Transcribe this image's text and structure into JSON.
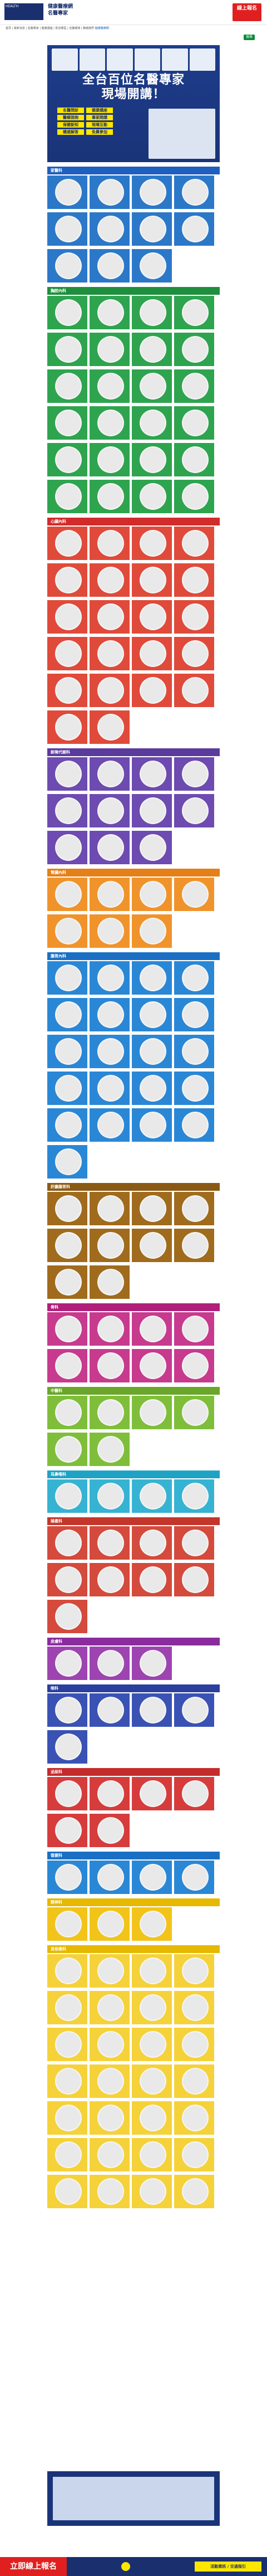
{
  "header": {
    "logo_text": "HEALTH",
    "brand_name": "健康醫療網",
    "sub_logo": "名醫專家",
    "cta_label": "線上報名"
  },
  "subnav": {
    "text": "首頁 | 最新消息 | 名醫專家 | 健康講座 | 影音專區 | 名醫報導 | 聯絡我們",
    "brand": "健康醫療網"
  },
  "search": {
    "button": "搜尋"
  },
  "hero": {
    "label": "名醫專家專區",
    "title_line1": "全台百位名醫專家",
    "title_line2": "現場開講！",
    "tags": [
      "名醫問診",
      "健康講座",
      "醫療諮詢",
      "專家開講",
      "保健新知",
      "現場互動",
      "權威解答",
      "免費參加"
    ]
  },
  "sections": [
    {
      "title": "家醫科",
      "color": "#1f5fbf",
      "cards": [
        "",
        "",
        "",
        "",
        "",
        "",
        "",
        "",
        "",
        "",
        ""
      ],
      "bg": "#2b78c9"
    },
    {
      "title": "胸腔內科",
      "color": "#1e8f3d",
      "cards": [
        "",
        "",
        "",
        "",
        "",
        "",
        "",
        "",
        "",
        "",
        "",
        "",
        "",
        "",
        "",
        "",
        "",
        "",
        "",
        "",
        "",
        "",
        "",
        ""
      ],
      "bg": "#2ea44f"
    },
    {
      "title": "心臟內科",
      "color": "#d22b2b",
      "cards": [
        "",
        "",
        "",
        "",
        "",
        "",
        "",
        "",
        "",
        "",
        "",
        "",
        "",
        "",
        "",
        "",
        "",
        "",
        "",
        "",
        "",
        ""
      ],
      "bg": "#e04a3a"
    },
    {
      "title": "新陳代謝科",
      "color": "#5b3a9e",
      "cards": [
        "",
        "",
        "",
        "",
        "",
        "",
        "",
        "",
        "",
        "",
        ""
      ],
      "bg": "#6d4bb0"
    },
    {
      "title": "腎臟內科",
      "color": "#e57f17",
      "cards": [
        "",
        "",
        "",
        "",
        "",
        "",
        ""
      ],
      "bg": "#f0932b"
    },
    {
      "title": "腸胃內科",
      "color": "#1a6fc4",
      "cards": [
        "",
        "",
        "",
        "",
        "",
        "",
        "",
        "",
        "",
        "",
        "",
        "",
        "",
        "",
        "",
        "",
        "",
        "",
        "",
        "",
        ""
      ],
      "bg": "#2a87d6"
    },
    {
      "title": "肝膽腸胃科",
      "color": "#8a5a14",
      "cards": [
        "",
        "",
        "",
        "",
        "",
        "",
        "",
        "",
        "",
        ""
      ],
      "bg": "#a06b1c"
    },
    {
      "title": "骨科",
      "color": "#b01f7a",
      "cards": [
        "",
        "",
        "",
        "",
        "",
        "",
        "",
        ""
      ],
      "bg": "#c73a8e"
    },
    {
      "title": "中醫科",
      "color": "#6aa62a",
      "cards": [
        "",
        "",
        "",
        "",
        "",
        ""
      ],
      "bg": "#7fbe3a"
    },
    {
      "title": "耳鼻喉科",
      "color": "#1fa3c4",
      "cards": [
        "",
        "",
        "",
        ""
      ],
      "bg": "#36b3d2"
    },
    {
      "title": "婦產科",
      "color": "#c2362b",
      "cards": [
        "",
        "",
        "",
        "",
        "",
        "",
        "",
        "",
        ""
      ],
      "bg": "#d44a3c"
    },
    {
      "title": "皮膚科",
      "color": "#8a2c9e",
      "cards": [
        "",
        "",
        ""
      ],
      "bg": "#9d44b0"
    },
    {
      "title": "眼科",
      "color": "#2b3f9e",
      "cards": [
        "",
        "",
        "",
        "",
        ""
      ],
      "bg": "#3a52b4"
    },
    {
      "title": "泌尿科",
      "color": "#c42b2b",
      "cards": [
        "",
        "",
        "",
        "",
        "",
        ""
      ],
      "bg": "#d63c3c"
    },
    {
      "title": "復健科",
      "color": "#1a6fc4",
      "cards": [
        "",
        "",
        "",
        ""
      ],
      "bg": "#2a87d6"
    },
    {
      "title": "精神科",
      "color": "#e6b800",
      "cards": [
        "",
        "",
        ""
      ],
      "bg": "#f2c41a"
    },
    {
      "title": "其他專科",
      "color": "#e6b800",
      "cards": [
        "",
        "",
        "",
        "",
        "",
        "",
        "",
        "",
        "",
        "",
        "",
        "",
        "",
        "",
        "",
        "",
        "",
        "",
        "",
        "",
        "",
        "",
        "",
        "",
        "",
        "",
        "",
        ""
      ],
      "bg": "#f5d23a"
    }
  ],
  "bottom": {
    "left_label": "立即線上報名",
    "right_label": "活動資訊 / 交通指引"
  }
}
